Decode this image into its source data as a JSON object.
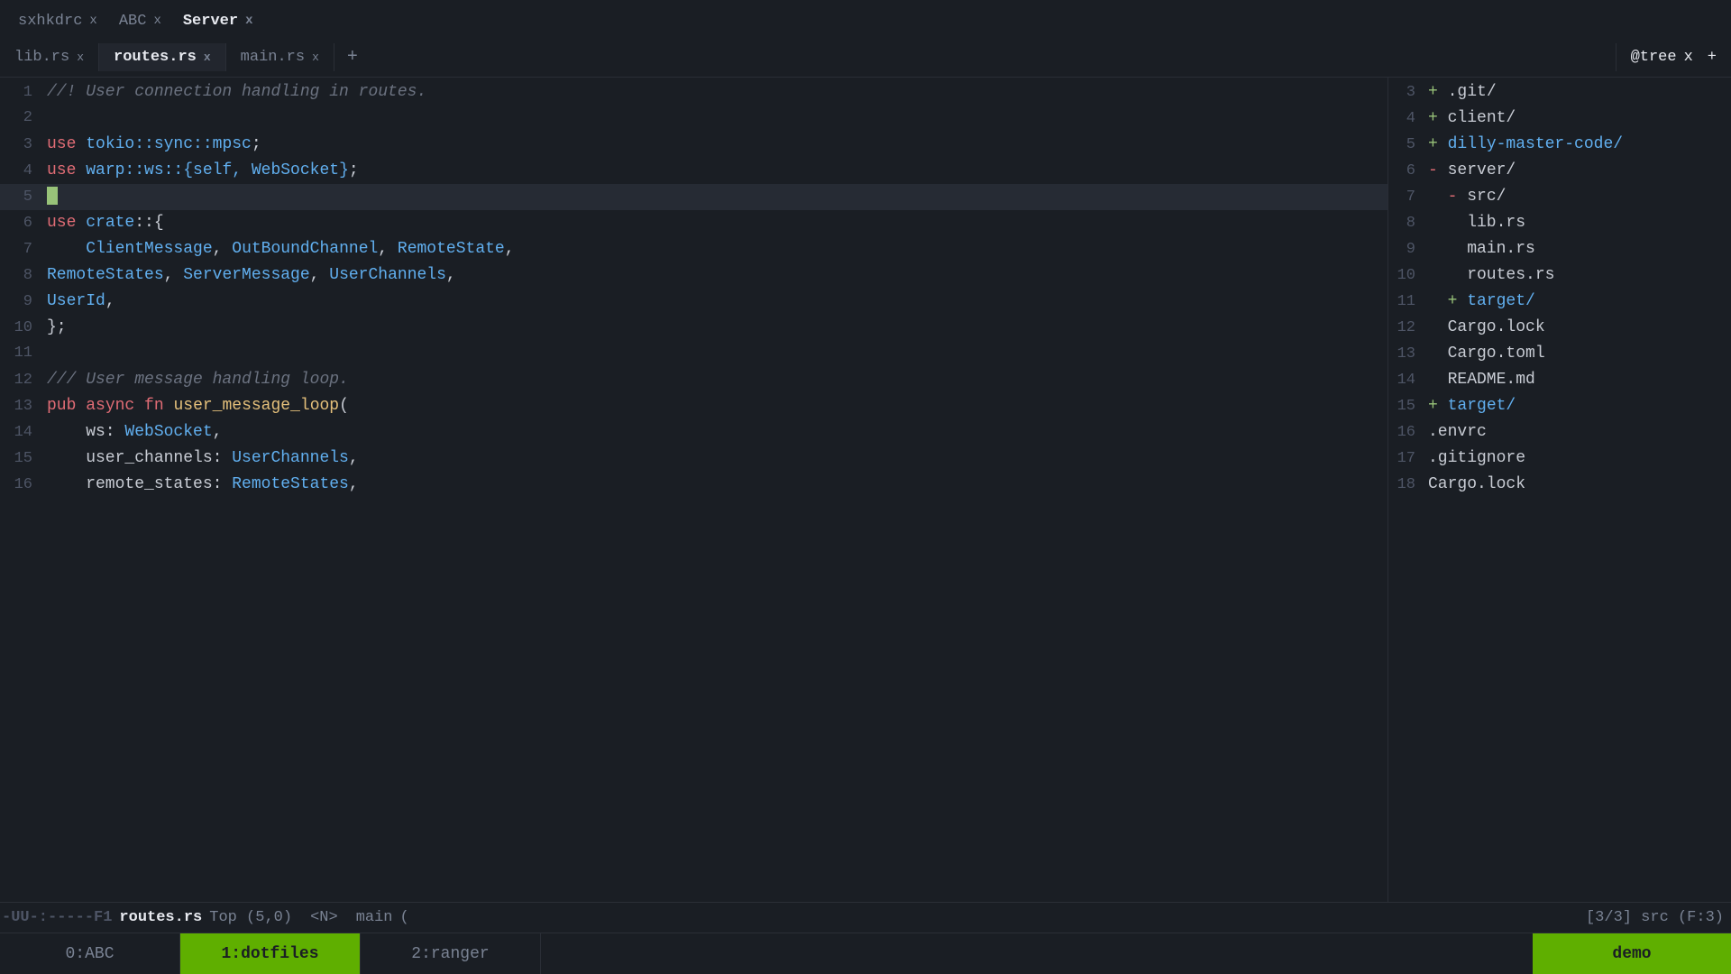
{
  "window_tabs": [
    {
      "label": "sxhkdrc",
      "close": "x",
      "active": false
    },
    {
      "label": "ABC",
      "close": "x",
      "active": false
    },
    {
      "label": "Server",
      "close": "x",
      "active": true
    }
  ],
  "file_tabs": [
    {
      "label": "lib.rs",
      "close": "x",
      "active": false
    },
    {
      "label": "routes.rs",
      "close": "x",
      "active": true
    },
    {
      "label": "main.rs",
      "close": "x",
      "active": false
    },
    {
      "label": "+",
      "close": "",
      "active": false
    }
  ],
  "tree_tab": {
    "label": "@tree",
    "close": "x"
  },
  "code_lines": [
    {
      "num": "1",
      "content": "//! User connection handling in routes.",
      "type": "comment"
    },
    {
      "num": "2",
      "content": "",
      "type": "plain"
    },
    {
      "num": "3",
      "content": "use tokio::sync::mpsc;",
      "type": "code"
    },
    {
      "num": "4",
      "content": "use warp::ws::{self, WebSocket};",
      "type": "code"
    },
    {
      "num": "5",
      "content": "",
      "type": "cursor"
    },
    {
      "num": "6",
      "content": "use crate::{",
      "type": "code"
    },
    {
      "num": "7",
      "content": "    ClientMessage, OutBoundChannel, RemoteState,",
      "type": "code"
    },
    {
      "num": "8",
      "content": "RemoteStates, ServerMessage, UserChannels,",
      "type": "code"
    },
    {
      "num": "9",
      "content": "UserId,",
      "type": "code"
    },
    {
      "num": "10",
      "content": "};",
      "type": "code"
    },
    {
      "num": "11",
      "content": "",
      "type": "plain"
    },
    {
      "num": "12",
      "content": "/// User message handling loop.",
      "type": "comment"
    },
    {
      "num": "13",
      "content": "pub async fn user_message_loop(",
      "type": "code"
    },
    {
      "num": "14",
      "content": "    ws: WebSocket,",
      "type": "code"
    },
    {
      "num": "15",
      "content": "    user_channels: UserChannels,",
      "type": "code"
    },
    {
      "num": "16",
      "content": "    remote_states: RemoteStates,",
      "type": "code"
    }
  ],
  "tree_lines": [
    {
      "num": "3",
      "prefix": "+ ",
      "content": ".git/",
      "type": "plus"
    },
    {
      "num": "4",
      "prefix": "+ ",
      "content": "client/",
      "type": "plus"
    },
    {
      "num": "5",
      "prefix": "+ ",
      "content": "dilly-master-code/",
      "type": "plus_blue"
    },
    {
      "num": "6",
      "prefix": "- ",
      "content": "server/",
      "type": "minus"
    },
    {
      "num": "7",
      "prefix": "  - ",
      "content": "src/",
      "type": "minus_indent"
    },
    {
      "num": "8",
      "prefix": "    ",
      "content": "lib.rs",
      "type": "plain"
    },
    {
      "num": "9",
      "prefix": "    ",
      "content": "main.rs",
      "type": "plain"
    },
    {
      "num": "10",
      "prefix": "    ",
      "content": "routes.rs",
      "type": "plain"
    },
    {
      "num": "11",
      "prefix": "  + ",
      "content": "target/",
      "type": "plus_indent_blue"
    },
    {
      "num": "12",
      "prefix": "  ",
      "content": "Cargo.lock",
      "type": "plain"
    },
    {
      "num": "13",
      "prefix": "  ",
      "content": "Cargo.toml",
      "type": "plain"
    },
    {
      "num": "14",
      "prefix": "  ",
      "content": "README.md",
      "type": "plain"
    },
    {
      "num": "15",
      "prefix": "+ ",
      "content": "target/",
      "type": "plus_blue"
    },
    {
      "num": "16",
      "prefix": "",
      "content": ".envrc",
      "type": "plain"
    },
    {
      "num": "17",
      "prefix": "",
      "content": ".gitignore",
      "type": "plain"
    },
    {
      "num": "18",
      "prefix": "",
      "content": "Cargo.lock",
      "type": "plain"
    }
  ],
  "status": {
    "mode": "-UU-:-----F1",
    "filename": "routes.rs",
    "position": "Top (5,0)",
    "nav": "<N>",
    "branch": "main",
    "extra": "(",
    "right": "[3/3]  src (F:3)"
  },
  "tmux_windows": [
    {
      "label": "0:ABC",
      "active": false
    },
    {
      "label": "1:dotfiles",
      "active": true
    },
    {
      "label": "2:ranger",
      "active": false
    }
  ],
  "tmux_right": "demo"
}
